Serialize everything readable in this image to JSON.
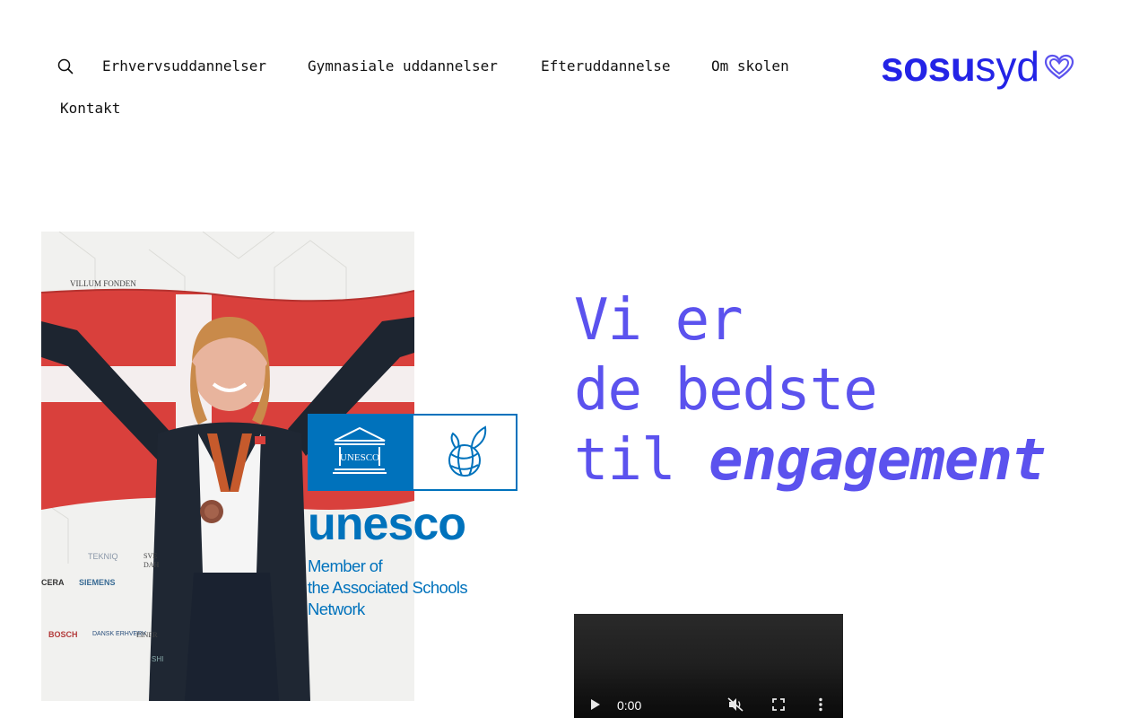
{
  "nav": {
    "search_icon": "search-icon",
    "links": [
      "Erhvervsuddannelser",
      "Gymnasiale uddannelser",
      "Efteruddannelse",
      "Om skolen",
      "Kontakt"
    ]
  },
  "logo": {
    "bold": "sosu",
    "light": "syd",
    "icon": "heart-icon",
    "color": "#2323e6"
  },
  "photo": {
    "flag_icon": "danish-flag",
    "backdrop_texts": [
      "VILLUM FONDEN",
      "TEKNIQ",
      "SIEMENS",
      "BOSCH",
      "DANSK ERHVERV",
      "EINER",
      "SVE",
      "DAH",
      "CERA",
      "SHI"
    ]
  },
  "unesco": {
    "emblem_text": "UNESCO",
    "wordmark": "unesco",
    "subtitle_lines": [
      "Member of",
      "the Associated Schools",
      "Network"
    ],
    "color": "#0072bc"
  },
  "headline": {
    "line1": "Vi er",
    "line2": "de bedste",
    "line3_prefix": "til ",
    "line3_emphasis": "engagement",
    "color": "#5b52ee"
  },
  "video": {
    "time": "0:00",
    "controls": [
      "play-icon",
      "mute-icon",
      "fullscreen-icon",
      "more-options-icon"
    ]
  }
}
